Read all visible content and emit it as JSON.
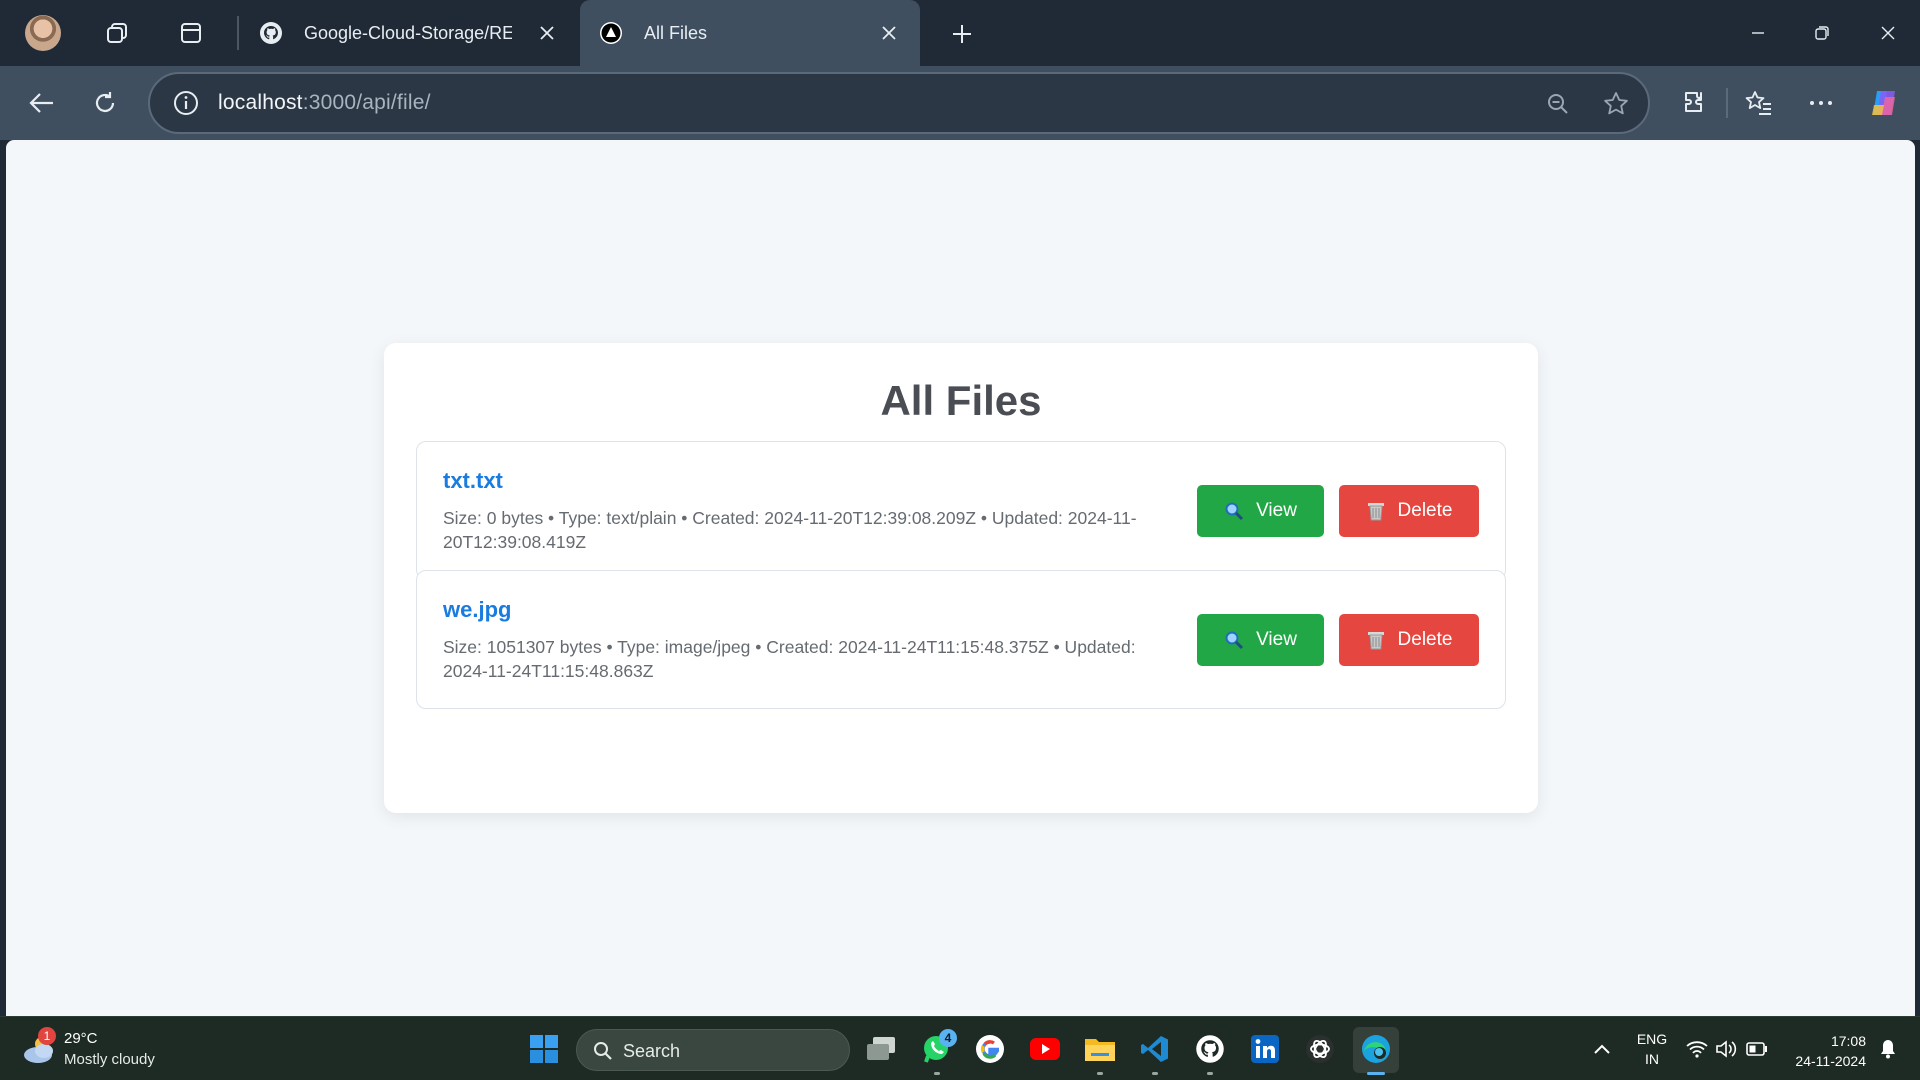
{
  "browser": {
    "tabs": [
      {
        "title": "Google-Cloud-Storage/REA",
        "favicon": "github-icon",
        "active": false
      },
      {
        "title": "All Files",
        "favicon": "nextjs-icon",
        "active": true
      }
    ],
    "url_host": "localhost",
    "url_rest": ":3000/api/file/"
  },
  "page": {
    "title": "All Files",
    "files": [
      {
        "name": "txt.txt",
        "meta": "Size: 0 bytes • Type: text/plain • Created: 2024-11-20T12:39:08.209Z • Updated: 2024-11-20T12:39:08.419Z",
        "view_label": "View",
        "delete_label": "Delete"
      },
      {
        "name": "we.jpg",
        "meta": "Size: 1051307 bytes • Type: image/jpeg • Created: 2024-11-24T11:15:48.375Z • Updated: 2024-11-24T11:15:48.863Z",
        "view_label": "View",
        "delete_label": "Delete"
      }
    ],
    "colors": {
      "view": "#22a746",
      "delete": "#e5463f",
      "link": "#1a7be0"
    }
  },
  "taskbar": {
    "weather": {
      "temp": "29°C",
      "desc": "Mostly cloudy",
      "badge": "1"
    },
    "search_label": "Search",
    "whatsapp_badge": "4",
    "language": {
      "line1": "ENG",
      "line2": "IN"
    },
    "clock": {
      "time": "17:08",
      "date": "24-11-2024"
    }
  }
}
